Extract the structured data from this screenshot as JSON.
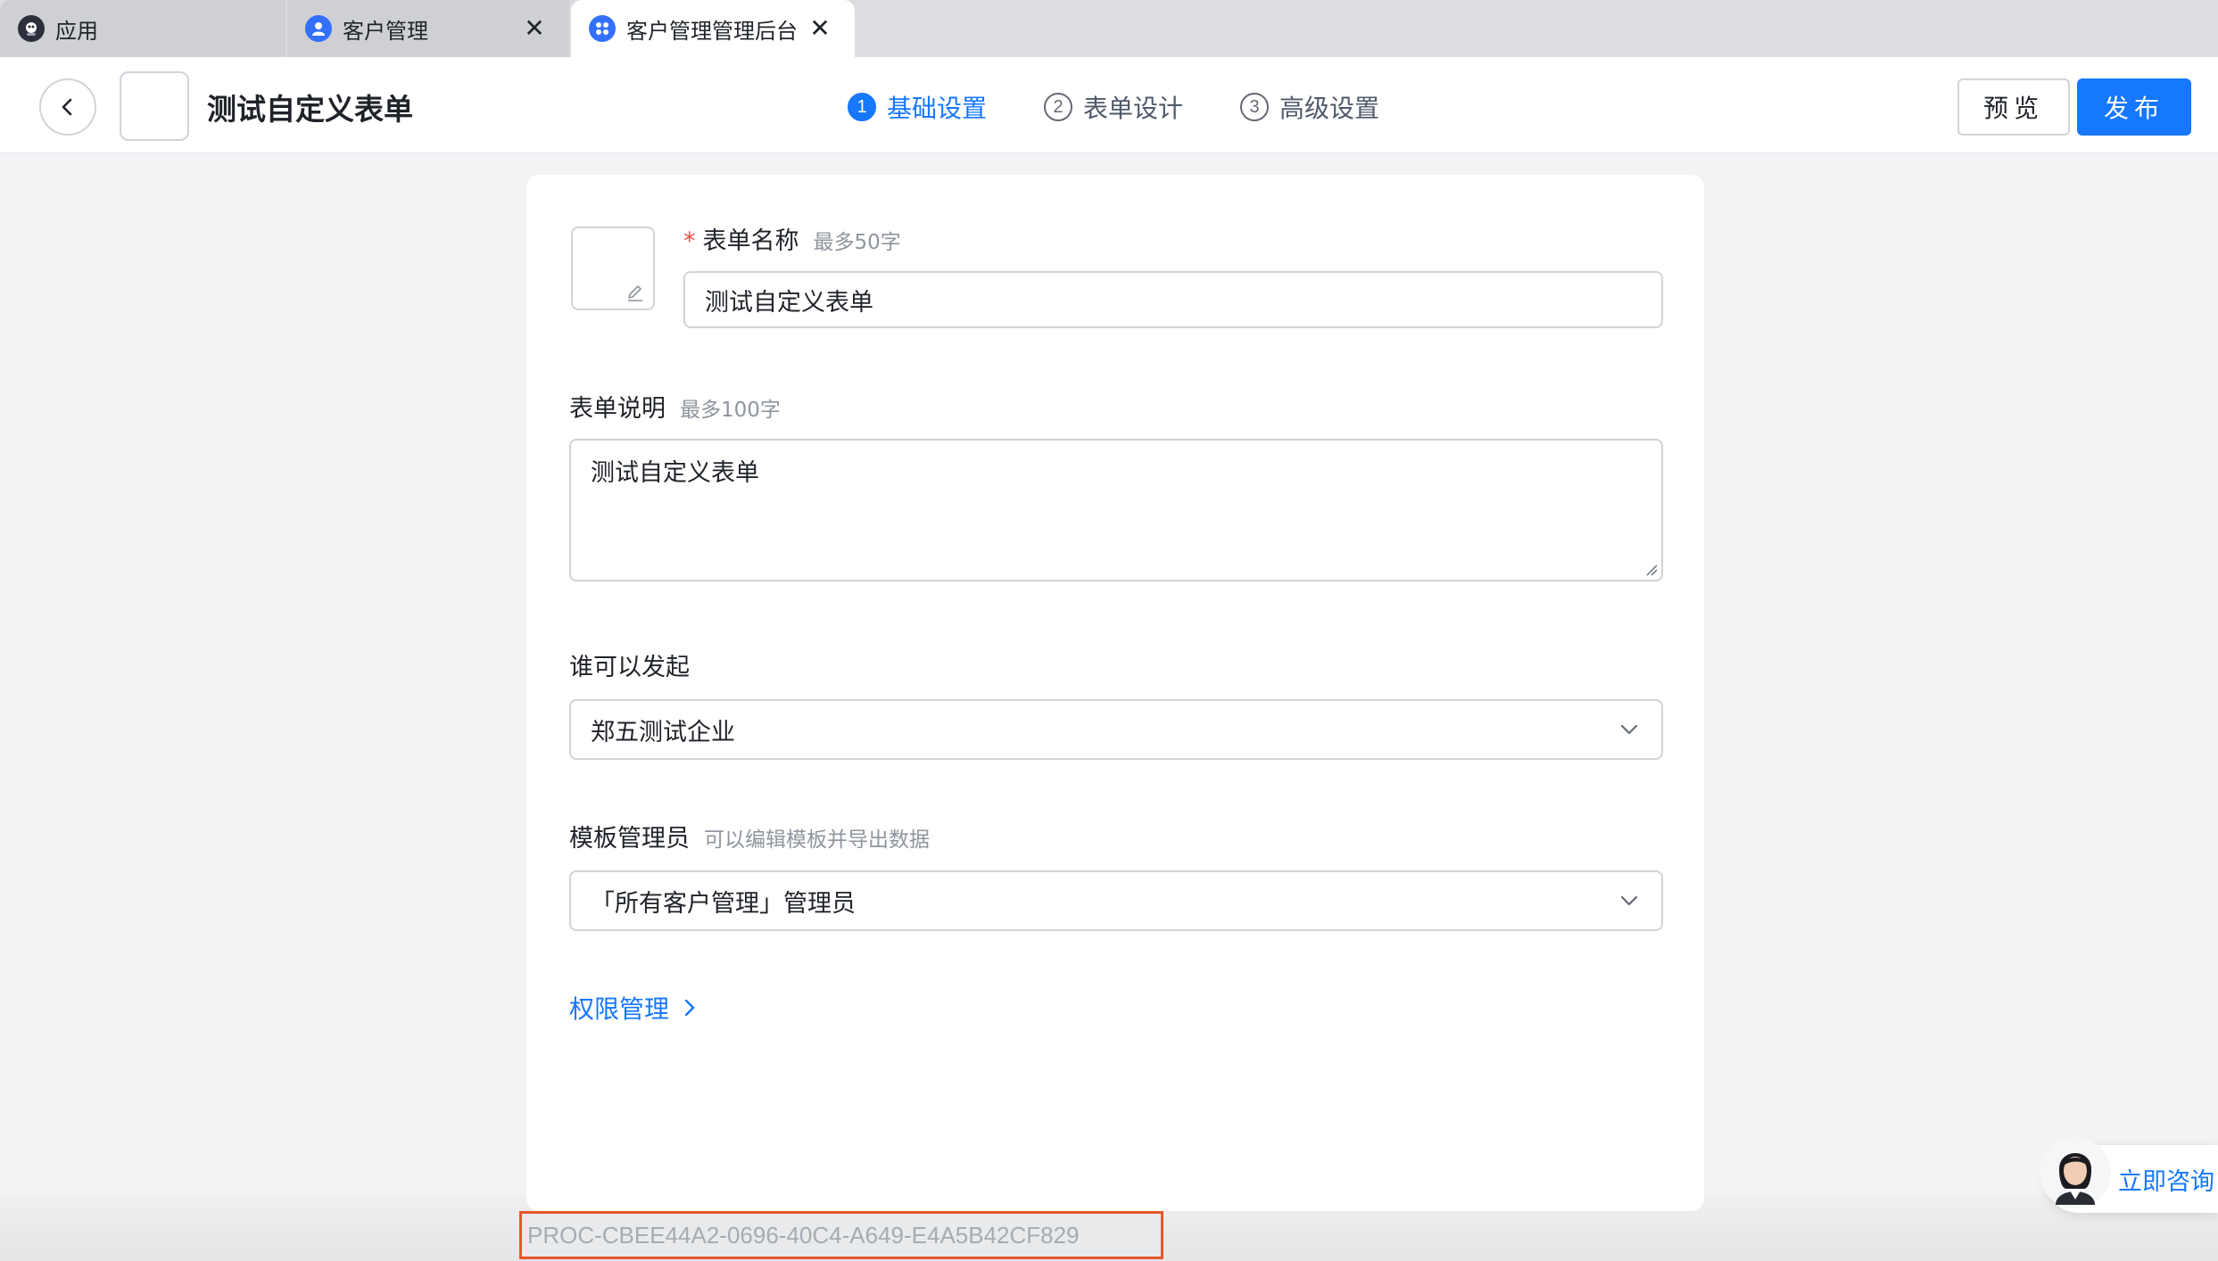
{
  "tabs": [
    {
      "label": "应用",
      "icon": "app-logo-icon",
      "active": false,
      "closable": false
    },
    {
      "label": "客户管理",
      "icon": "user-icon",
      "active": false,
      "closable": true
    },
    {
      "label": "客户管理管理后台",
      "icon": "grid-apps-icon",
      "active": true,
      "closable": true
    }
  ],
  "header": {
    "title": "测试自定义表单",
    "steps": [
      {
        "num": "1",
        "label": "基础设置",
        "active": true
      },
      {
        "num": "2",
        "label": "表单设计",
        "active": false
      },
      {
        "num": "3",
        "label": "高级设置",
        "active": false
      }
    ],
    "preview_label": "预览",
    "publish_label": "发布"
  },
  "form": {
    "name": {
      "label": "表单名称",
      "hint": "最多50字",
      "value": "测试自定义表单"
    },
    "desc": {
      "label": "表单说明",
      "hint": "最多100字",
      "value": "测试自定义表单"
    },
    "initiator": {
      "label": "谁可以发起",
      "value": "郑五测试企业"
    },
    "admin": {
      "label": "模板管理员",
      "hint": "可以编辑模板并导出数据",
      "value": "「所有客户管理」管理员"
    },
    "permission_link": "权限管理"
  },
  "process_id": "PROC-CBEE44A2-0696-40C4-A649-E4A5B42CF829",
  "consult_label": "立即咨询",
  "colors": {
    "primary": "#1677ff",
    "required": "#f54a45",
    "highlight_border": "#e8562a"
  }
}
